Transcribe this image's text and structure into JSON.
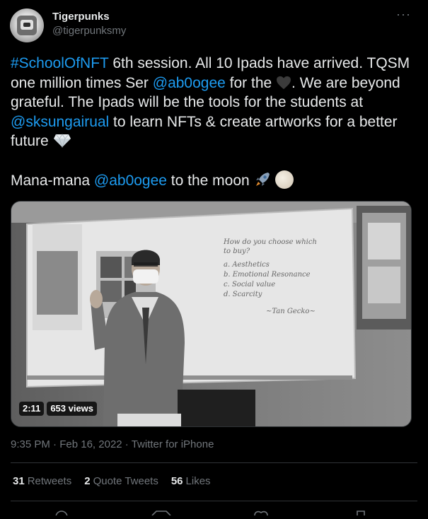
{
  "author": {
    "name": "Tigerpunks",
    "handle": "@tigerpunksmy"
  },
  "tweet": {
    "hashtag": "#SchoolOfNFT",
    "part1": " 6th session. All 10 Ipads have arrived. TQSM one million times Ser ",
    "mention1": "@ab0ogee",
    "part2": " for the ",
    "part3": ". We are beyond grateful. The Ipads will be the tools for the students at ",
    "mention2": "@sksungairual",
    "part4": " to learn NFTs & create artworks for a better future ",
    "line2_prefix": "Mana-mana ",
    "mention3": "@ab0ogee",
    "line2_suffix": " to the moon "
  },
  "media": {
    "duration": "2:11",
    "views": "653 views",
    "whiteboard_lines": [
      "How do you choose which",
      "to buy?",
      "a. Aesthetics",
      "b. Emotional Resonance",
      "c. Social value",
      "d. Scarcity",
      "~Tan Gecko~"
    ]
  },
  "meta": {
    "time": "9:35 PM",
    "sep": " · ",
    "date": "Feb 16, 2022",
    "via": "Twitter for iPhone"
  },
  "stats": {
    "retweets_count": "31",
    "retweets_label": "Retweets",
    "quotes_count": "2",
    "quotes_label": "Quote Tweets",
    "likes_count": "56",
    "likes_label": "Likes"
  },
  "icons": {
    "more": "more-dots-icon",
    "heart": "black-heart-icon",
    "gem": "gem-stone-icon",
    "rocket": "rocket-icon",
    "moon": "full-moon-icon"
  },
  "colors": {
    "background": "#000000",
    "text": "#e7e9ea",
    "secondary": "#71767b",
    "link": "#1d9bf0",
    "divider": "#2f3336"
  }
}
